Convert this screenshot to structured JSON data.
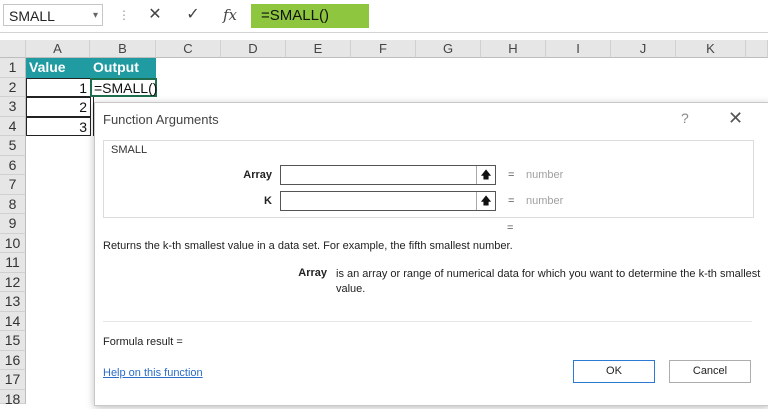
{
  "formula_bar": {
    "name_box": "SMALL",
    "cancel_icon": "✕",
    "enter_icon": "✓",
    "fx_label": "fx",
    "formula": "=SMALL()"
  },
  "grid": {
    "columns": [
      "A",
      "B",
      "C",
      "D",
      "E",
      "F",
      "G",
      "H",
      "I",
      "J",
      "K"
    ],
    "rows": [
      "1",
      "2",
      "3",
      "4",
      "5",
      "6",
      "7",
      "8",
      "9",
      "10",
      "11",
      "12",
      "13",
      "14",
      "15",
      "16",
      "17",
      "18"
    ],
    "header_color": "#1f9ba1",
    "a1": "Value",
    "b1": "Output",
    "values": [
      "1",
      "2",
      "3"
    ],
    "b2": "=SMALL()"
  },
  "dialog": {
    "title": "Function Arguments",
    "help_icon": "?",
    "close_icon": "✕",
    "function_name": "SMALL",
    "args": [
      {
        "label": "Array",
        "value": "",
        "equals": "=",
        "hint": "number"
      },
      {
        "label": "K",
        "value": "",
        "equals": "=",
        "hint": "number"
      }
    ],
    "result_equals": "=",
    "description": "Returns the k-th smallest value in a data set. For example, the fifth smallest number.",
    "arg_help_name": "Array",
    "arg_help_text": "is an array or range of numerical data for which you want to determine the k-th smallest value.",
    "formula_result": "Formula result =",
    "help_link": "Help on this function",
    "ok_label": "OK",
    "cancel_label": "Cancel"
  }
}
